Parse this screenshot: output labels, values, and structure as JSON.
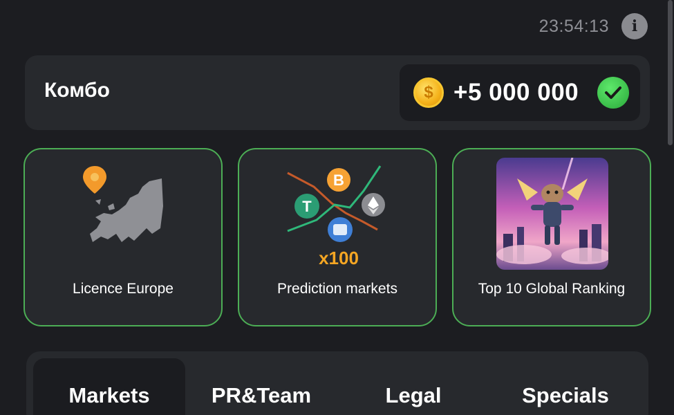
{
  "header": {
    "timer": "23:54:13",
    "info_icon": "info-icon"
  },
  "combo": {
    "title": "Комбо",
    "reward": "+5 000 000",
    "coin_symbol": "$",
    "claimed": true
  },
  "cards": [
    {
      "label": "Licence Europe",
      "icon": "europe-map-icon"
    },
    {
      "label": "Prediction markets",
      "icon": "prediction-markets-icon",
      "badge": "x100"
    },
    {
      "label": "Top 10 Global Ranking",
      "icon": "hamster-flying-image"
    }
  ],
  "tabs": [
    {
      "label": "Markets",
      "active": true
    },
    {
      "label": "PR&Team",
      "active": false
    },
    {
      "label": "Legal",
      "active": false
    },
    {
      "label": "Specials",
      "active": false
    }
  ],
  "colors": {
    "background": "#1c1d21",
    "card": "#27292d",
    "card_border": "#4cae55",
    "timer": "#8e8f95",
    "badge_orange": "#f5a623"
  }
}
